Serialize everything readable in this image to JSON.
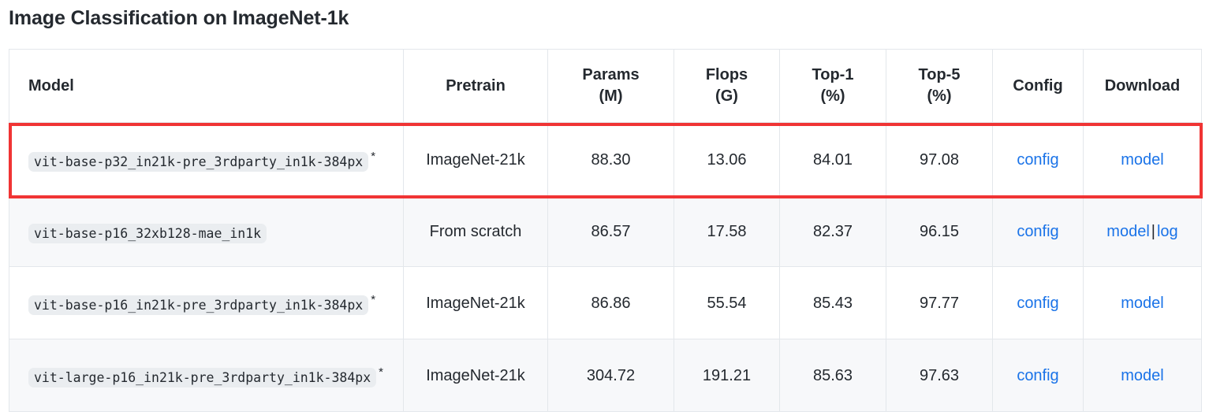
{
  "page": {
    "title": "Image Classification on ImageNet-1k"
  },
  "table": {
    "headers": [
      {
        "label": "Model"
      },
      {
        "label": "Pretrain"
      },
      {
        "label_line1": "Params",
        "label_line2": "(M)"
      },
      {
        "label_line1": "Flops",
        "label_line2": "(G)"
      },
      {
        "label_line1": "Top-1",
        "label_line2": "(%)"
      },
      {
        "label_line1": "Top-5",
        "label_line2": "(%)"
      },
      {
        "label": "Config"
      },
      {
        "label": "Download"
      }
    ],
    "rows": [
      {
        "model": "vit-base-p32_in21k-pre_3rdparty_in1k-384px",
        "model_star": "*",
        "pretrain": "ImageNet-21k",
        "params_m": "88.30",
        "flops_g": "13.06",
        "top1": "84.01",
        "top5": "97.08",
        "config": "config",
        "download": [
          "model"
        ],
        "highlighted": true
      },
      {
        "model": "vit-base-p16_32xb128-mae_in1k",
        "model_star": "",
        "pretrain": "From scratch",
        "params_m": "86.57",
        "flops_g": "17.58",
        "top1": "82.37",
        "top5": "96.15",
        "config": "config",
        "download": [
          "model",
          "log"
        ],
        "highlighted": false
      },
      {
        "model": "vit-base-p16_in21k-pre_3rdparty_in1k-384px",
        "model_star": "*",
        "pretrain": "ImageNet-21k",
        "params_m": "86.86",
        "flops_g": "55.54",
        "top1": "85.43",
        "top5": "97.77",
        "config": "config",
        "download": [
          "model"
        ],
        "highlighted": false
      },
      {
        "model": "vit-large-p16_in21k-pre_3rdparty_in1k-384px",
        "model_star": "*",
        "pretrain": "ImageNet-21k",
        "params_m": "304.72",
        "flops_g": "191.21",
        "top1": "85.63",
        "top5": "97.63",
        "config": "config",
        "download": [
          "model"
        ],
        "highlighted": false
      }
    ],
    "link_separator": "|"
  },
  "colors": {
    "link": "#1a73e8",
    "highlight_border": "#f03434",
    "code_background": "#eaedf0",
    "row_alt_background": "#f7f8fa",
    "text": "#24292f",
    "table_border": "#e3e7eb"
  }
}
